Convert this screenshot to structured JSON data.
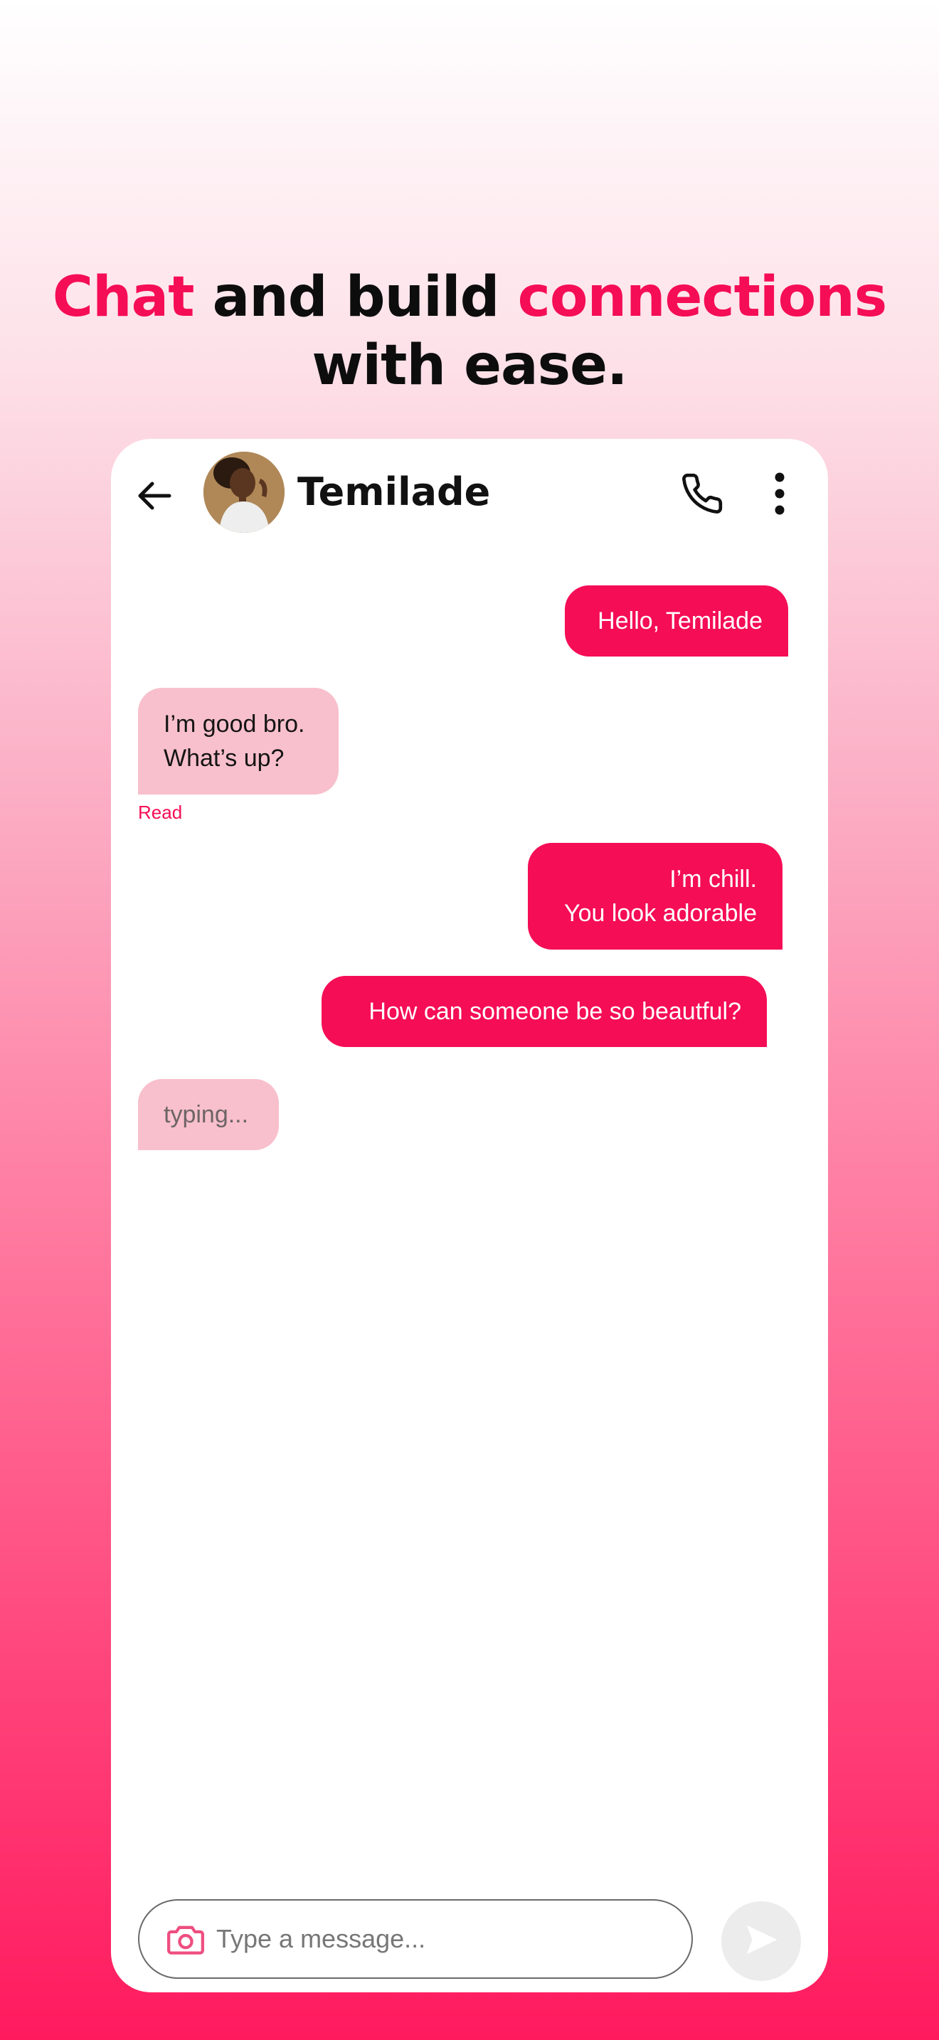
{
  "headline": {
    "line1_accent_a": "Chat",
    "line1_mid": " and build ",
    "line1_accent_b": "connections",
    "line2": "with ease."
  },
  "colors": {
    "accent": "#f50d56",
    "incoming_bubble": "#f8c0cc",
    "send_button": "#ececec"
  },
  "chat_header": {
    "back_icon": "arrow-left-icon",
    "avatar": "contact-avatar",
    "contact_name": "Temilade",
    "call_icon": "phone-icon",
    "menu_icon": "more-vertical-icon"
  },
  "messages": [
    {
      "direction": "outgoing",
      "lines": [
        "Hello, Temilade"
      ]
    },
    {
      "direction": "incoming",
      "lines": [
        "I’m good bro.",
        "What’s up?"
      ],
      "status": "Read"
    },
    {
      "direction": "outgoing",
      "lines": [
        "I’m chill.",
        "You look adorable"
      ]
    },
    {
      "direction": "outgoing",
      "lines": [
        "How can someone be so beautful?"
      ]
    },
    {
      "direction": "incoming",
      "lines": [
        "typing..."
      ]
    }
  ],
  "composer": {
    "camera_icon": "camera-icon",
    "placeholder": "Type a message...",
    "value": "",
    "send_icon": "send-icon"
  }
}
